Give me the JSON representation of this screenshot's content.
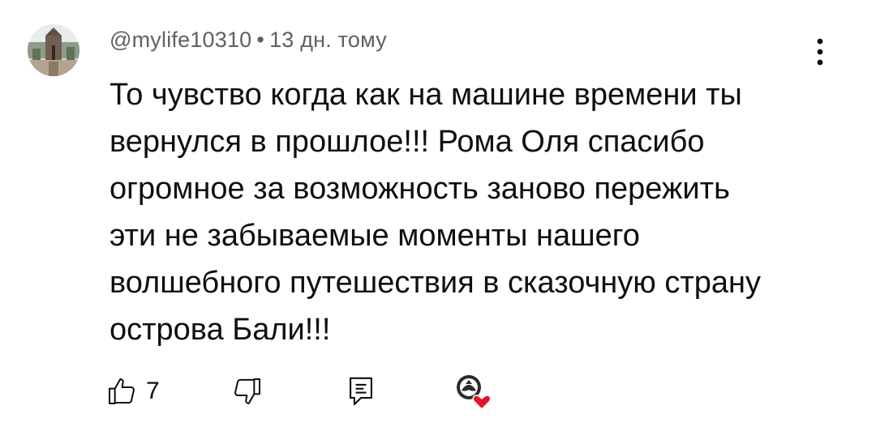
{
  "comment": {
    "author": "@mylife10310",
    "separator": "•",
    "timestamp": "13 дн. тому",
    "text": "То чувство когда как на машине времени ты\nвернулся в прошлое!!! Рома Оля спасибо\nогромное за возможность заново пережить\nэти не забываемые моменты нашего\nволшебного путешествия в сказочную страну\nострова Бали!!!",
    "likes": "7"
  },
  "icons": {
    "avatar": "avatar-photo",
    "menu": "more-vertical-icon",
    "like": "thumb-up-icon",
    "dislike": "thumb-down-icon",
    "reply": "reply-comment-icon",
    "heart": "creator-heart-icon"
  },
  "colors": {
    "text": "#0f0f0f",
    "meta": "#606060",
    "heart": "#e3142b"
  }
}
